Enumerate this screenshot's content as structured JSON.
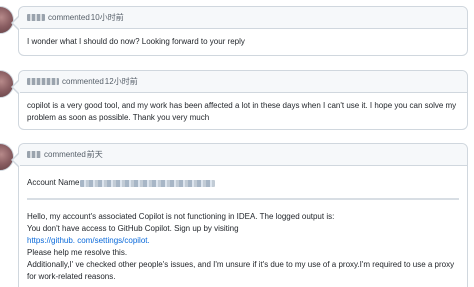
{
  "comments": [
    {
      "verb": "commented",
      "time": "10小时前",
      "body": "I wonder what I should do now? Looking forward to your reply"
    },
    {
      "verb": "commented",
      "time": "12小时前",
      "body": "copilot is a very good tool, and my work has been affected a lot in these days when I can't use it. I hope you can solve my problem as soon as possible. Thank you very much"
    },
    {
      "verb": "commented",
      "time": "前天",
      "account_label": "Account Name",
      "lines": [
        "Hello, my account's associated Copilot is not functioning in IDEA. The logged output is:",
        "You don't have access to GitHub Copilot. Sign up by visiting"
      ],
      "link": "https://github. com/settings/copilot.",
      "lines_after": [
        "Please help me resolve this.",
        "Additionally,I' ve checked other people's issues, and I'm unsure if it's due to my use of a proxy.I'm required to use a proxy for work-related reasons."
      ]
    }
  ]
}
